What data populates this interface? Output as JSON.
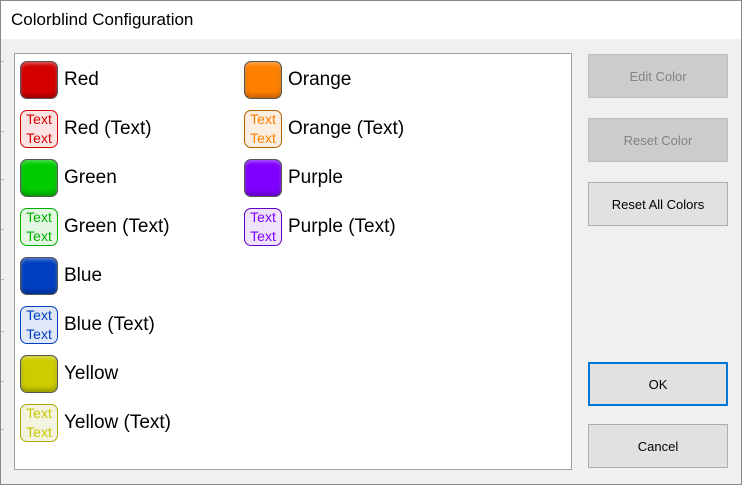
{
  "window": {
    "title": "Colorblind Configuration"
  },
  "colors": {
    "red": "#d40000",
    "orange": "#ff8000",
    "green": "#00cc00",
    "purple": "#8000ff",
    "blue": "#0040c0",
    "yellow": "#cccc00",
    "default_button_border": "#0078d7"
  },
  "items": [
    {
      "label": "Red",
      "kind": "solid",
      "color": "#d40000"
    },
    {
      "label": "Red (Text)",
      "kind": "text",
      "color": "#d40000",
      "bg": "#fbe3e3",
      "text_lines": [
        "Text",
        "Text"
      ]
    },
    {
      "label": "Green",
      "kind": "solid",
      "color": "#00cc00"
    },
    {
      "label": "Green (Text)",
      "kind": "text",
      "color": "#00b000",
      "bg": "#e3f7e3",
      "text_lines": [
        "Text",
        "Text"
      ]
    },
    {
      "label": "Blue",
      "kind": "solid",
      "color": "#0040c0"
    },
    {
      "label": "Blue (Text)",
      "kind": "text",
      "color": "#0040c0",
      "bg": "#e0e8f8",
      "text_lines": [
        "Text",
        "Text"
      ]
    },
    {
      "label": "Yellow",
      "kind": "solid",
      "color": "#cccc00"
    },
    {
      "label": "Yellow (Text)",
      "kind": "text",
      "color": "#c8c800",
      "bg": "#f3f3e0",
      "text_lines": [
        "Text",
        "Text"
      ]
    },
    {
      "label": "Orange",
      "kind": "solid",
      "color": "#ff8000"
    },
    {
      "label": "Orange (Text)",
      "kind": "text",
      "color": "#ff8000",
      "bg": "#fbeee0",
      "text_lines": [
        "Text",
        "Text"
      ]
    },
    {
      "label": "Purple",
      "kind": "solid",
      "color": "#8000ff"
    },
    {
      "label": "Purple (Text)",
      "kind": "text",
      "color": "#8000ff",
      "bg": "#eee3fb",
      "text_lines": [
        "Text",
        "Text"
      ]
    }
  ],
  "buttons": {
    "edit_color": "Edit Color",
    "reset_color": "Reset Color",
    "reset_all_colors": "Reset All Colors",
    "ok": "OK",
    "cancel": "Cancel"
  }
}
